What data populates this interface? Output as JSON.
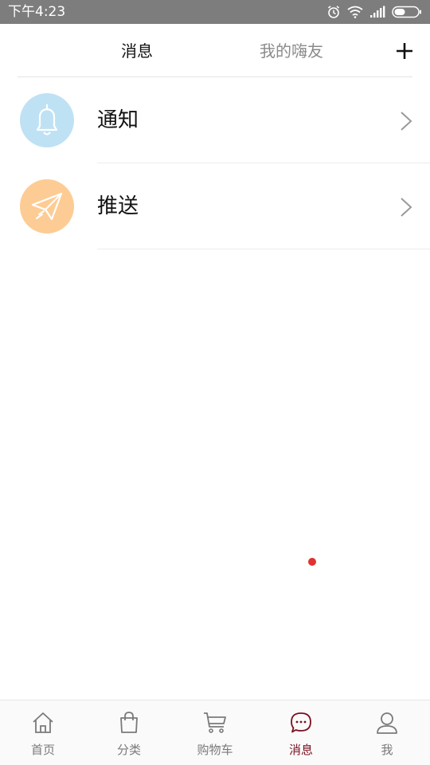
{
  "status_bar": {
    "time": "下午4:23",
    "icons": [
      "alarm-icon",
      "wifi-icon",
      "signal-icon",
      "battery-icon"
    ],
    "background": "#7d7d7d"
  },
  "header": {
    "tabs": [
      {
        "label": "消息",
        "active": true
      },
      {
        "label": "我的嗨友",
        "active": false
      }
    ],
    "add_icon": "plus-icon"
  },
  "list": {
    "items": [
      {
        "label": "通知",
        "icon": "bell-icon",
        "icon_bg": "#bfe1f4"
      },
      {
        "label": "推送",
        "icon": "paper-plane-icon",
        "icon_bg": "#fdcc94"
      }
    ]
  },
  "bottom_nav": {
    "items": [
      {
        "label": "首页",
        "icon": "home-icon",
        "active": false
      },
      {
        "label": "分类",
        "icon": "bag-icon",
        "active": false
      },
      {
        "label": "购物车",
        "icon": "cart-icon",
        "active": false
      },
      {
        "label": "消息",
        "icon": "chat-bubble-icon",
        "active": true
      },
      {
        "label": "我",
        "icon": "person-icon",
        "active": false
      }
    ],
    "active_color": "#7a1020"
  }
}
